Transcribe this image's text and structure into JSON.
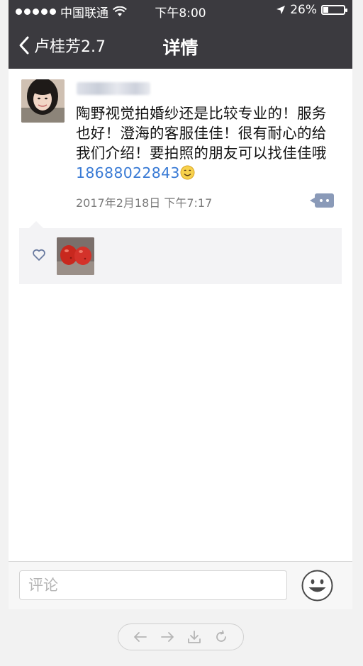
{
  "status_bar": {
    "carrier": "中国联通",
    "time": "下午8:00",
    "battery": "26%",
    "battery_level": 0.26
  },
  "nav": {
    "back_label": "卢桂芳2.7",
    "title": "详情"
  },
  "post": {
    "text": "陶野视觉拍婚纱还是比较专业的！服务也好！澄海的客服佳佳！很有耐心的给我们介绍！要拍照的朋友可以找佳佳哦",
    "phone": "18688022843",
    "timestamp": "2017年2月18日 下午7:17"
  },
  "comment_bar": {
    "placeholder": "评论"
  },
  "colors": {
    "header_bg": "#3b3a3f",
    "link": "#3a7bd5",
    "likes_bg": "#f3f3f5"
  },
  "icons": {
    "back": "chevron-left-icon",
    "comment": "comment-dots-icon",
    "like": "heart-outline-icon",
    "emoji": "smiley-face-icon",
    "toolbar": [
      "arrow-left-icon",
      "arrow-right-icon",
      "download-icon",
      "refresh-icon"
    ]
  }
}
